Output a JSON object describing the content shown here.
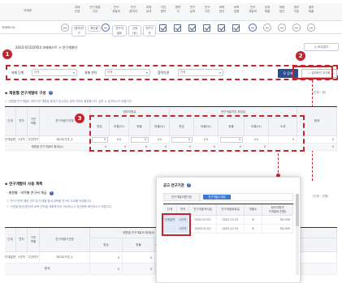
{
  "status_grid": {
    "headers": [
      "과제명",
      "과제\n선정",
      "연구개발\n기관",
      "연구\n개발비",
      "연구\n참여자",
      "과제\n상세",
      "기관\n협약",
      "협약\n서",
      "연구\n실적",
      "연구\n기관",
      "비목\n정산",
      "비목\n집행",
      "연구\n개발비",
      "성과\n제출",
      "최종\n정산",
      "정부\n지분",
      "결과\n제출"
    ],
    "row": {
      "task_name": "과제테스트",
      "pills": [
        "(협약)연구",
        "확인중",
        "연구개발비",
        "신청(등)",
        "연구기관"
      ],
      "extra_circle_label": "⊖"
    }
  },
  "breadcrumb": "2023-01222954 과제테스트 > 연구개발비",
  "fold_button": "◎ 모두접기",
  "filter": {
    "label1": "과제 단계",
    "sel1": "전체",
    "label2": "과제 연차",
    "sel2": "전체",
    "label3": "참여기관",
    "sel3": "전체",
    "search": "Q 검색",
    "reset": "○ 검색조건 초기화"
  },
  "badges": [
    "1",
    "2",
    "3"
  ],
  "section1": {
    "title": "재원별 연구개발비 구성",
    "help": "?",
    "unit": "(단위 : 원)",
    "info": "ⓘ 재원별 연구개발비 세부기관 재원별 합계가 표시되는 금액 이하로 결정합니다. 입력 시 유의하시기 바랍니다.",
    "col_headers": {
      "stage": "단계",
      "year": "연차",
      "org": "기관\n역할",
      "org_name": "연구개발기관명",
      "gov_group": "정부지원금",
      "private_group": "연구개발기관 부담금",
      "cash": "현금",
      "ratio": "비율(%)",
      "inkind": "현물",
      "subtotal": "소계",
      "total": "합계"
    },
    "rows": [
      {
        "stage": "단계일반",
        "year": "1년차",
        "role": "주관연구",
        "org_name": "테스트기관_4",
        "gov_cash": "0",
        "gov_ratio": "0.0",
        "gov_inkind": "0",
        "gov_inratio": "0.0",
        "pr_cash": "0",
        "pr_ratio": "0.0",
        "pr_inkind": "0",
        "pr_inratio": "0.0",
        "subtotal": "0",
        "total": "0"
      }
    ],
    "sum_label": "재원별 연구개발비 합계(A)",
    "sum_values": [
      "0",
      "0",
      "0",
      "0",
      "0",
      "0",
      "0",
      "0",
      "0"
    ]
  },
  "section2": {
    "title": "연구개발비 사용 계획",
    "subtitle": "· 재원별 · 비목별 연구비 계급",
    "help": "?",
    "unit": "(단위 : 천원)",
    "info1": "ⓘ 연구기관의 해당 연차 및 단계별 합계 비목별 연구비 소요를 작성합니다.",
    "info2": "ⓘ 기관별 정산(증빙)의 비목 연차별 계획에 따라 작성하시고 정산항목 확인하시기 바랍니다.",
    "col_headers": {
      "stage": "단계",
      "year": "연차",
      "org": "기관\n역할",
      "org_name": "연구개발기관명",
      "gov_group": "재원별 연구개발비 합계(A)",
      "cash": "현금",
      "inkind": "현물",
      "subtotal": "소계"
    },
    "rows": [
      {
        "stage": "단계일반",
        "year": "1년차",
        "role": "주관연구",
        "org_name": "테스트기관_4",
        "cash": "0",
        "inkind": "0",
        "subtotal": "0"
      }
    ],
    "sum_label": "합계",
    "sum_values": [
      "0",
      "0",
      "0"
    ]
  },
  "popup": {
    "title": "공고 연구기관",
    "help": "?",
    "filter_label": "연구개발지원구분",
    "filter_value": "연구개발수계정",
    "col_headers": [
      "단계",
      "연차",
      "연구개발개시일",
      "연구개발종료일",
      "개월수",
      "정부지원연\n구개발비(천원)"
    ],
    "rows": [
      {
        "stage": "단계일반",
        "year": "1년차",
        "start": "2022.07.01",
        "end": "2022.12.31",
        "months": "6",
        "amount": "50,000"
      },
      {
        "stage": "",
        "year": "2년차",
        "start": "2023.01.01",
        "end": "2023.12.31",
        "months": "6",
        "amount": "50,000"
      }
    ]
  },
  "colors": {
    "accent_red": "#c0262b",
    "primary_blue": "#2d4e8a",
    "info_blue": "#6b7fae"
  }
}
